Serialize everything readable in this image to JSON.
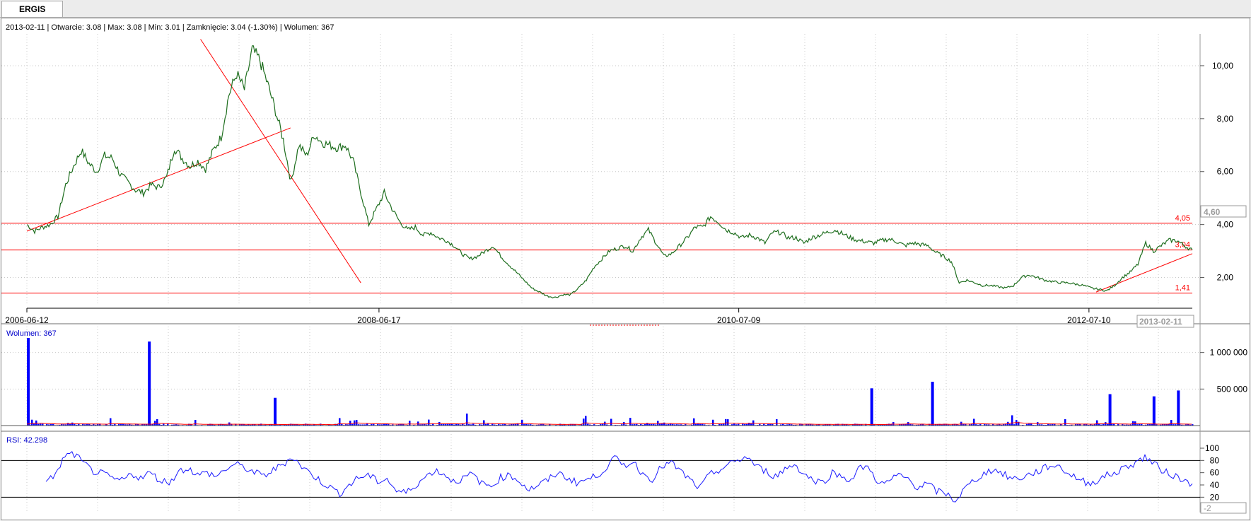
{
  "tab": {
    "label": "ERGIS"
  },
  "info_line": "2013-02-11 | Otwarcie: 3.08 | Max: 3.08 | Min: 3.01 | Zamknięcie: 3.04 (-1.30%)  | Wolumen: 367",
  "volume_label": "Wolumen: 367",
  "rsi_label": "RSI: 42.298",
  "price_marker": "4,60",
  "date_marker": "2013-02-11",
  "rsi_marker": "-2",
  "colors": {
    "price": "#1e6e1e",
    "trend": "#ff0000",
    "volume": "#0000ff",
    "volume_ma": "#ff0000",
    "rsi": "#1a1aff",
    "grid": "#c8c8c8"
  },
  "chart_data": [
    {
      "type": "line",
      "x_ticks": [
        "2006-06-12",
        "2008-06-17",
        "2010-07-09",
        "2012-07-10"
      ],
      "y_ticks": [
        "10,00",
        "8,00",
        "6,00",
        "4,00",
        "2,00"
      ],
      "ylim": [
        1.0,
        11.2
      ],
      "grid": true,
      "levels": [
        {
          "value": 4.05,
          "label": "4,05"
        },
        {
          "value": 3.04,
          "label": "3,04"
        },
        {
          "value": 1.41,
          "label": "1,41"
        }
      ],
      "series": [
        {
          "values": [
            4.0,
            3.75,
            3.9,
            4.0,
            4.3,
            5.5,
            6.2,
            6.8,
            6.3,
            6.0,
            6.6,
            6.5,
            5.9,
            5.6,
            5.3,
            5.2,
            5.5,
            5.4,
            5.8,
            6.9,
            6.5,
            6.2,
            6.4,
            6.1,
            6.8,
            7.3,
            8.9,
            9.7,
            9.1,
            10.6,
            10.2,
            9.3,
            8.3,
            7.2,
            5.6,
            7.0,
            6.6,
            7.4,
            7.1,
            7.0,
            6.9,
            7.0,
            6.4,
            5.2,
            4.0,
            4.6,
            5.2,
            4.6,
            4.1,
            3.8,
            3.9,
            3.6,
            3.7,
            3.5,
            3.4,
            3.2,
            2.9,
            2.7,
            2.8,
            3.0,
            3.2,
            2.8,
            2.5,
            2.2,
            1.9,
            1.6,
            1.45,
            1.3,
            1.25,
            1.35,
            1.35,
            1.6,
            1.9,
            2.4,
            2.7,
            3.0,
            3.1,
            3.2,
            3.0,
            3.5,
            3.8,
            3.3,
            2.8,
            2.9,
            3.2,
            3.5,
            3.9,
            3.9,
            4.3,
            4.1,
            3.8,
            3.7,
            3.5,
            3.6,
            3.5,
            3.3,
            3.7,
            3.7,
            3.5,
            3.5,
            3.3,
            3.5,
            3.6,
            3.7,
            3.8,
            3.65,
            3.5,
            3.4,
            3.35,
            3.3,
            3.4,
            3.45,
            3.35,
            3.2,
            3.3,
            3.25,
            3.2,
            2.95,
            2.8,
            2.6,
            1.8,
            1.9,
            1.8,
            1.7,
            1.7,
            1.65,
            1.6,
            1.7,
            2.0,
            2.1,
            2.0,
            1.9,
            1.85,
            1.8,
            1.8,
            1.75,
            1.7,
            1.6,
            1.55,
            1.5,
            1.7,
            2.0,
            2.2,
            2.5,
            3.3,
            3.0,
            3.2,
            3.4,
            3.4,
            3.2,
            3.04
          ]
        }
      ],
      "trendlines": [
        {
          "from": [
            "2006-06-12",
            3.75
          ],
          "to": [
            "2007-12-15",
            7.65
          ]
        },
        {
          "from": [
            "2007-06-10",
            11.0
          ],
          "to": [
            "2008-05-10",
            1.8
          ]
        },
        {
          "from": [
            "2012-07-25",
            1.45
          ],
          "to": [
            "2013-02-11",
            2.9
          ]
        }
      ]
    },
    {
      "type": "bar",
      "title": "Wolumen: 367",
      "y_ticks": [
        "1 000 000",
        "500 000"
      ],
      "ylim": [
        0,
        1200000
      ],
      "spikes": [
        {
          "date": "2006-06-12",
          "value": 1200000
        },
        {
          "date": "2007-02-20",
          "value": 1150000
        },
        {
          "date": "2007-11-10",
          "value": 380000
        },
        {
          "date": "2011-04-10",
          "value": 510000
        },
        {
          "date": "2011-08-15",
          "value": 600000
        },
        {
          "date": "2012-08-20",
          "value": 430000
        },
        {
          "date": "2012-11-20",
          "value": 400000
        },
        {
          "date": "2013-01-10",
          "value": 480000
        }
      ],
      "grid": true
    },
    {
      "type": "line",
      "title": "RSI: 42.298",
      "y_ticks": [
        "100",
        "80",
        "60",
        "40",
        "20"
      ],
      "ylim": [
        -5,
        100
      ],
      "levels": [
        80,
        20
      ],
      "series": [
        {
          "values": [
            50,
            55,
            88,
            90,
            75,
            62,
            58,
            50,
            47,
            58,
            52,
            60,
            48,
            44,
            62,
            68,
            56,
            60,
            54,
            66,
            74,
            68,
            60,
            55,
            64,
            74,
            86,
            70,
            58,
            46,
            36,
            26,
            40,
            52,
            56,
            46,
            50,
            30,
            27,
            40,
            52,
            64,
            58,
            46,
            50,
            58,
            42,
            38,
            52,
            56,
            46,
            32,
            40,
            48,
            60,
            52,
            44,
            48,
            54,
            66,
            84,
            72,
            78,
            58,
            50,
            70,
            76,
            62,
            48,
            34,
            56,
            64,
            72,
            80,
            86,
            70,
            62,
            54,
            66,
            74,
            58,
            48,
            44,
            60,
            54,
            48,
            70,
            66,
            40,
            46,
            56,
            50,
            36,
            42,
            30,
            26,
            14,
            34,
            48,
            58,
            66,
            58,
            50,
            52,
            58,
            64,
            72,
            70,
            58,
            50,
            42,
            48,
            56,
            60,
            70,
            76,
            86,
            74,
            62,
            56,
            48,
            42
          ]
        }
      ]
    }
  ]
}
